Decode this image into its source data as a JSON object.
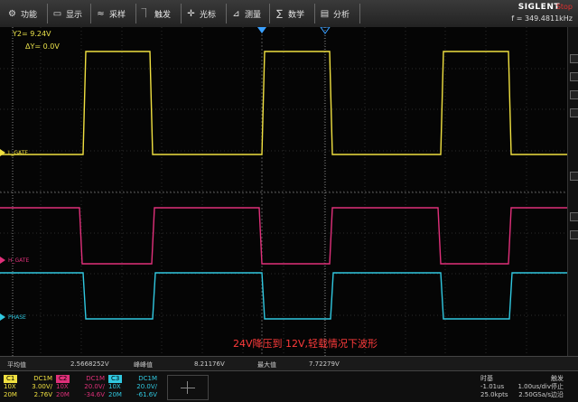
{
  "menu": [
    {
      "icon": "gear-icon",
      "glyph": "⚙",
      "label": "功能"
    },
    {
      "icon": "display-icon",
      "glyph": "▭",
      "label": "显示"
    },
    {
      "icon": "sample-icon",
      "glyph": "≈",
      "label": "采样"
    },
    {
      "icon": "trigger-icon",
      "glyph": "⏋",
      "label": "触发"
    },
    {
      "icon": "cursor-icon",
      "glyph": "✛",
      "label": "光标"
    },
    {
      "icon": "measure-icon",
      "glyph": "⊿",
      "label": "测量"
    },
    {
      "icon": "math-icon",
      "glyph": "∑",
      "label": "数学"
    },
    {
      "icon": "analysis-icon",
      "glyph": "▤",
      "label": "分析"
    }
  ],
  "brand": "SIGLENT",
  "status": "Stop",
  "frequency": "f = 349.4811kHz",
  "cursor": {
    "y2": "Y2= 9.24V",
    "dy": "ΔY= 0.0V"
  },
  "channel_labels": {
    "c1": "L_GATE",
    "c2": "H_GATE",
    "c3": "PHASE"
  },
  "caption": "24V降压到 12V,轻载情况下波形",
  "measurements": [
    {
      "label": "平均值",
      "value": "2.5668252V"
    },
    {
      "label": "峰峰值",
      "value": "8.21176V"
    },
    {
      "label": "最大值",
      "value": "7.72279V"
    }
  ],
  "channels": [
    {
      "name": "C1",
      "color": "#f0e040",
      "coupling": "DC1M",
      "probe": "10X",
      "scale": "3.00V/",
      "bw": "20M",
      "offset": "2.76V"
    },
    {
      "name": "C2",
      "color": "#e0307a",
      "coupling": "DC1M",
      "probe": "10X",
      "scale": "20.0V/",
      "bw": "20M",
      "offset": "-34.6V"
    },
    {
      "name": "C3",
      "color": "#30c8e0",
      "coupling": "DC1M",
      "probe": "10X",
      "scale": "20.0V/",
      "bw": "20M",
      "offset": "-61.6V"
    }
  ],
  "timebase": {
    "title": "时基",
    "delay": "-1.01us",
    "scale": "1.00us/div",
    "points": "25.0kpts",
    "rate": "2.50GSa/s"
  },
  "trigger": {
    "title": "触发",
    "state": "停止",
    "type": "边沿"
  },
  "colors": {
    "ch1": "#f0e040",
    "ch2": "#e0307a",
    "ch3": "#30c8e0",
    "stop": "#e03030"
  }
}
